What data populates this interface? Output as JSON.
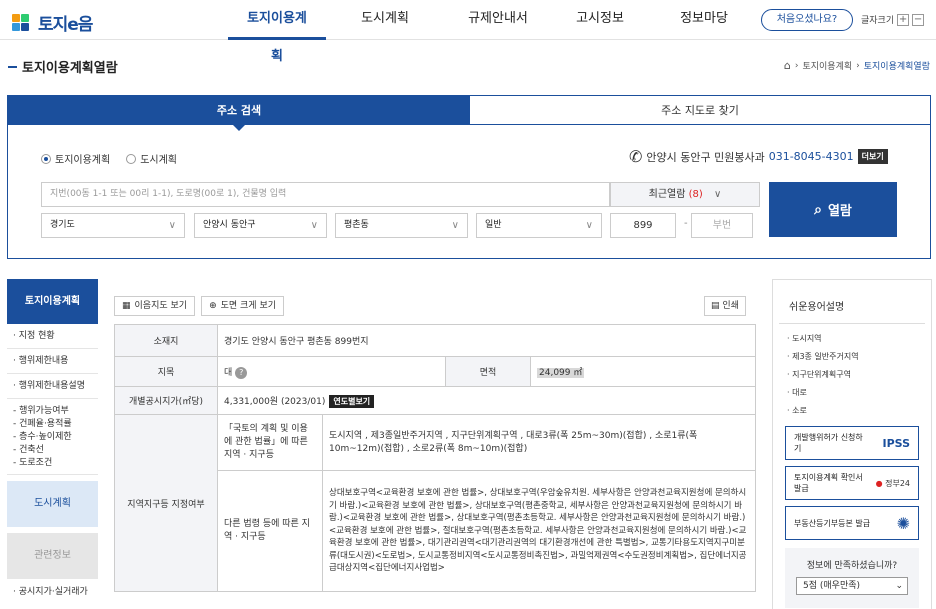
{
  "header": {
    "logo_text": "토지e음",
    "nav": [
      "토지이용계획",
      "도시계획",
      "규제안내서",
      "고시정보",
      "정보마당"
    ],
    "first_visit": "처음오셨나요?",
    "font_size_label": "글자크기",
    "font_plus": "+",
    "font_minus": "−"
  },
  "page": {
    "title": "토지이용계획열람",
    "breadcrumb": [
      "토지이용계획",
      "토지이용계획열람"
    ]
  },
  "search": {
    "tab_address": "주소 검색",
    "tab_map": "주소 지도로 찾기",
    "radio_1": "토지이용계획",
    "radio_2": "도시계획",
    "contact_office": "안양시 동안구 민원봉사과",
    "contact_phone": "031-8045-4301",
    "more": "더보기",
    "address_placeholder": "지번(00동 1-1 또는 00리 1-1), 도로명(00로 1), 건물명 입력",
    "recent_label": "최근열람",
    "recent_count": "(8)",
    "sido": "경기도",
    "sigungu": "안양시 동안구",
    "dong": "평촌동",
    "type": "일반",
    "main_no": "899",
    "sub_no_placeholder": "부번",
    "view_button": "열람"
  },
  "left_nav": {
    "top": "토지이용계획",
    "items": [
      "지정 현황",
      "행위제한내용",
      "행위제한내용설명"
    ],
    "sub_items": [
      "행위가능여부",
      "건폐율·용적률",
      "층수·높이제한",
      "건축선",
      "도로조건"
    ],
    "city_plan": "도시계획",
    "related": "관련정보",
    "foot": "공시지가·실거래가"
  },
  "tools": {
    "map_btn": "이음지도 보기",
    "zoom_btn": "도면 크게 보기",
    "print_btn": "인쇄"
  },
  "info": {
    "location_label": "소재지",
    "location": "경기도 안양시 동안구 평촌동 899번지",
    "jimok_label": "지목",
    "jimok": "대",
    "area_label": "면적",
    "area": "24,099 ㎡",
    "price_label": "개별공시지가(㎡당)",
    "price": "4,331,000원 (2023/01)",
    "price_btn": "연도별보기",
    "zone_label": "지역지구등 지정여부",
    "law1_label": "「국토의 계획 및 이용에 관한 법률」에 따른 지역 · 지구등",
    "law1_value": "도시지역 , 제3종일반주거지역 , 지구단위계획구역 , 대로3류(폭 25m~30m)(접합) , 소로1류(폭 10m~12m)(접합) , 소로2류(폭 8m~10m)(접합)",
    "law2_label": "다른 법령 등에 따른 지역 · 지구등",
    "law2_value": "상대보호구역<교육환경 보호에 관한 법률>, 상대보호구역(우암숲유치원. 세부사항은 안양과천교육지원청에 문의하시기 바람.)<교육환경 보호에 관한 법률>, 상대보호구역(평촌중학교, 세부사항은 안양과천교육지원청에 문의하시기 바람.)<교육환경 보호에 관한 법률>, 상대보호구역(평촌초등학교. 세부사항은 안양과천교육지원청에 문의하시기 바람.)<교육환경 보호에 관한 법률>, 절대보호구역(평촌초등학교. 세부사항은 안양과천교육지원청에 문의하시기 바람.)<교육환경 보호에 관한 법률>, 대기관리권역<대기관리권역의 대기환경개선에 관한 특별법>, 교통기타용도지역지구미분류(대도시권)<도로법>, 도시교통정비지역<도시교통정비촉진법>, 과밀억제권역<수도권정비계획법>, 집단에너지공급대상지역<집단에너지사업법>"
  },
  "right": {
    "title": "쉬운용어설명",
    "terms": [
      "도시지역",
      "제3종 일반주거지역",
      "지구단위계획구역",
      "대로",
      "소로"
    ],
    "btn1": "개발행위허가 신청하기",
    "btn1_badge": "IPSS",
    "btn2": "토지이용계획 확인서 발급",
    "btn2_badge": "정부24",
    "btn3": "부동산등기부등본 발급",
    "satisfy_q": "정보에 만족하셨습니까?",
    "satisfy_val": "5점 (매우만족)"
  }
}
